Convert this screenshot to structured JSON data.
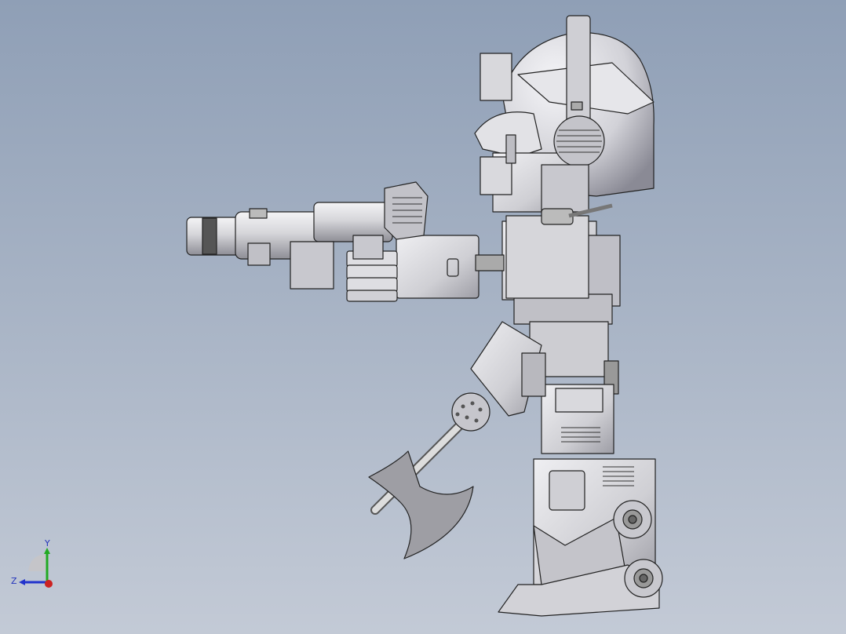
{
  "scene": {
    "model": "robot-figure-side-view",
    "background_top": "#8f9fb6",
    "background_bottom": "#c3cad6",
    "part_fill": "#d3d3d7",
    "part_shade": "#a9a9b0",
    "edge_color": "#222222"
  },
  "triad": {
    "y_label": "Y",
    "z_label": "Z",
    "y_axis_color": "#22aa22",
    "z_axis_color": "#2233cc",
    "x_axis_color": "#cc2222"
  }
}
